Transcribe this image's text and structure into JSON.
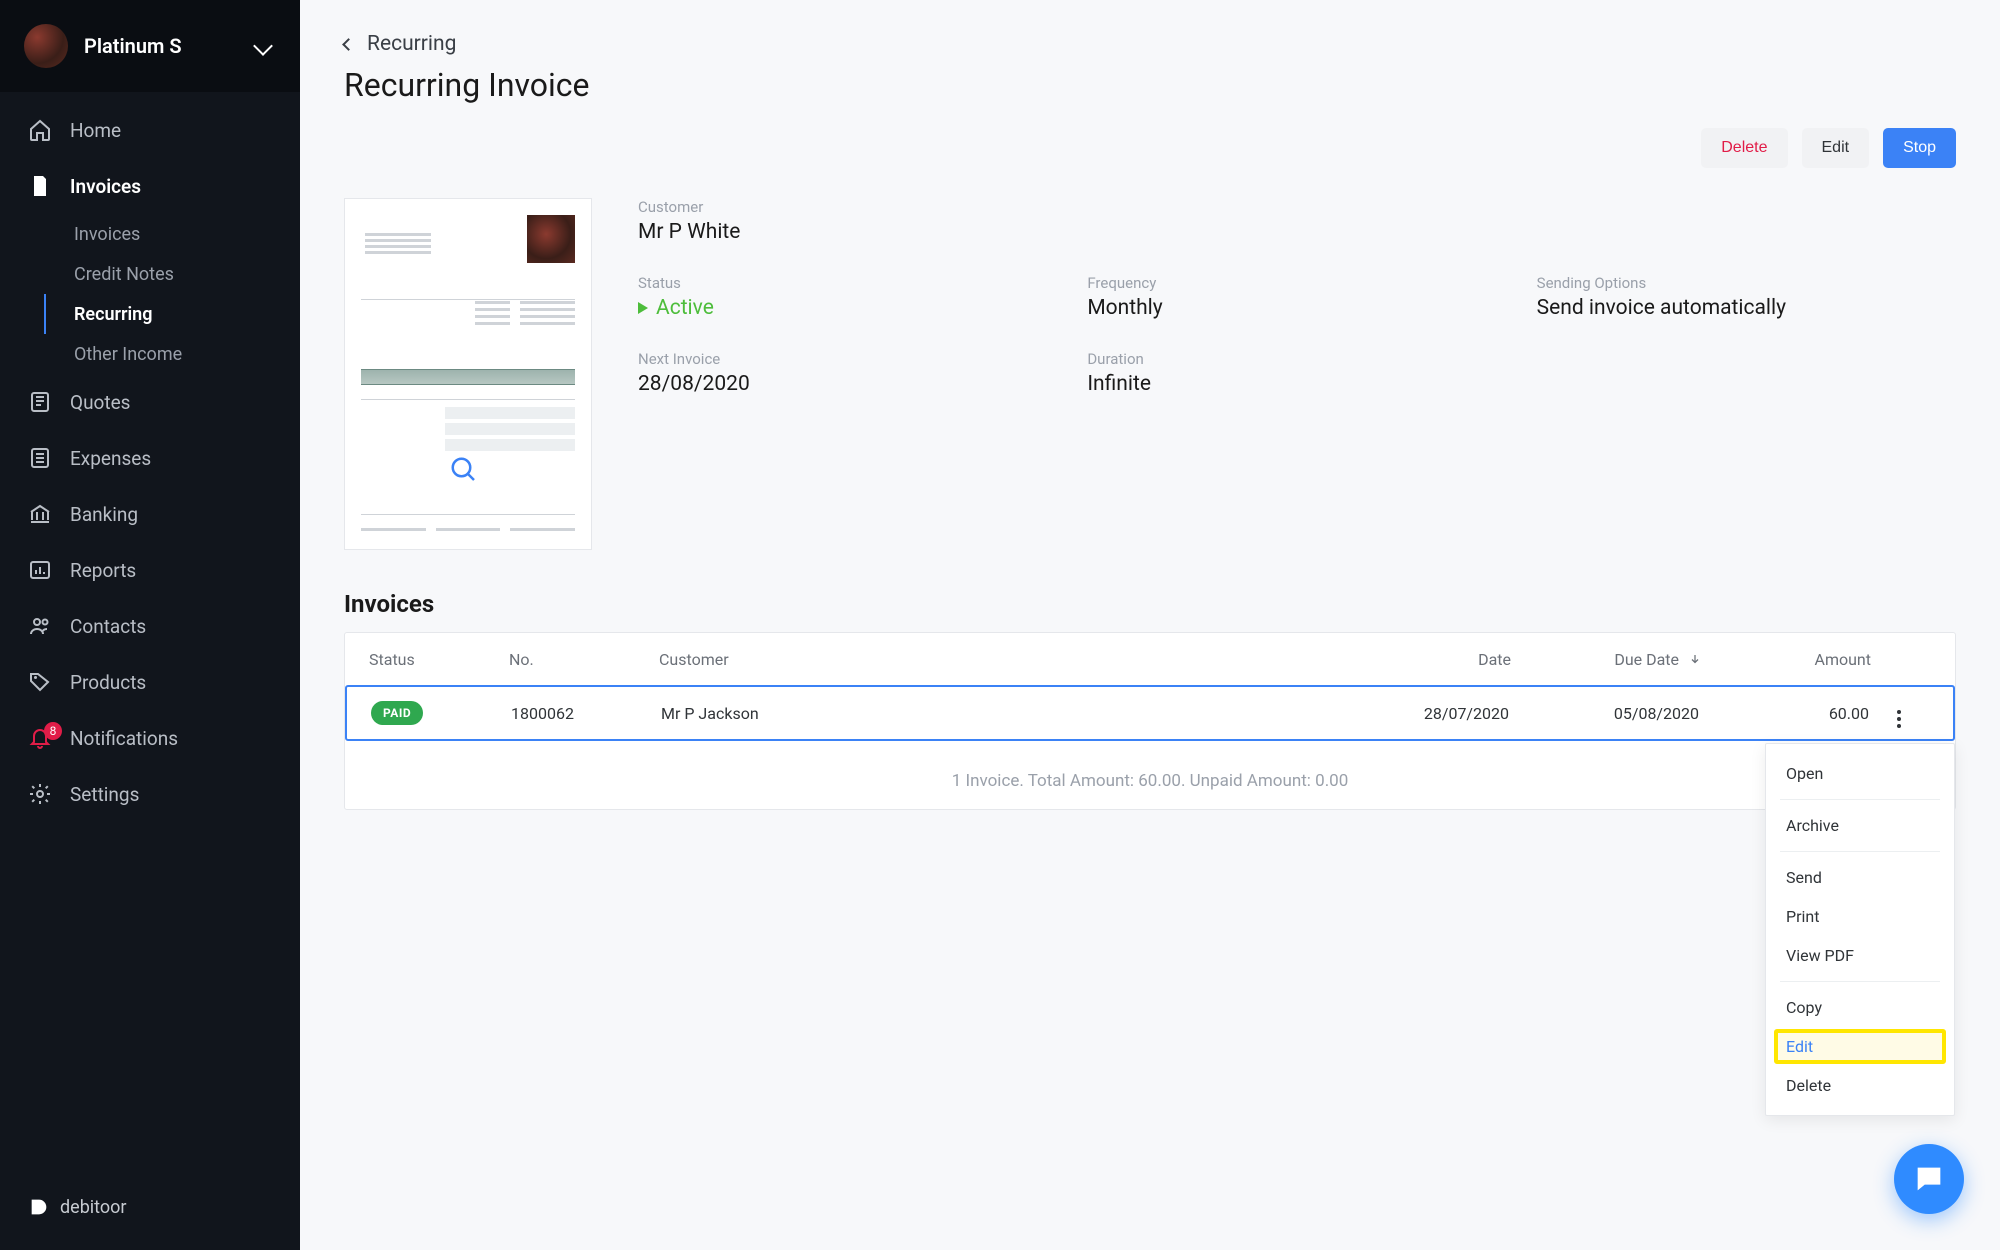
{
  "account": {
    "name": "Platinum S"
  },
  "sidebar": {
    "items": [
      {
        "label": "Home"
      },
      {
        "label": "Invoices"
      },
      {
        "label": "Quotes"
      },
      {
        "label": "Expenses"
      },
      {
        "label": "Banking"
      },
      {
        "label": "Reports"
      },
      {
        "label": "Contacts"
      },
      {
        "label": "Products"
      },
      {
        "label": "Notifications",
        "badge": "8"
      },
      {
        "label": "Settings"
      }
    ],
    "invoices_sub": [
      {
        "label": "Invoices"
      },
      {
        "label": "Credit Notes"
      },
      {
        "label": "Recurring"
      },
      {
        "label": "Other Income"
      }
    ]
  },
  "brand": "debitoor",
  "breadcrumb": "Recurring",
  "page_title": "Recurring Invoice",
  "actions": {
    "delete": "Delete",
    "edit": "Edit",
    "stop": "Stop"
  },
  "detail": {
    "customer_label": "Customer",
    "customer": "Mr P White",
    "status_label": "Status",
    "status": "Active",
    "frequency_label": "Frequency",
    "frequency": "Monthly",
    "sending_label": "Sending Options",
    "sending": "Send invoice automatically",
    "next_label": "Next Invoice",
    "next": "28/08/2020",
    "duration_label": "Duration",
    "duration": "Infinite"
  },
  "invoices_section": "Invoices",
  "table": {
    "headers": {
      "status": "Status",
      "no": "No.",
      "customer": "Customer",
      "date": "Date",
      "due": "Due Date",
      "amount": "Amount"
    },
    "rows": [
      {
        "status": "PAID",
        "no": "1800062",
        "customer": "Mr P Jackson",
        "date": "28/07/2020",
        "due": "05/08/2020",
        "amount": "60.00"
      }
    ],
    "summary": "1 Invoice. Total Amount: 60.00. Unpaid Amount: 0.00"
  },
  "dropdown": {
    "open": "Open",
    "archive": "Archive",
    "send": "Send",
    "print": "Print",
    "view_pdf": "View PDF",
    "copy": "Copy",
    "edit": "Edit",
    "delete": "Delete"
  }
}
